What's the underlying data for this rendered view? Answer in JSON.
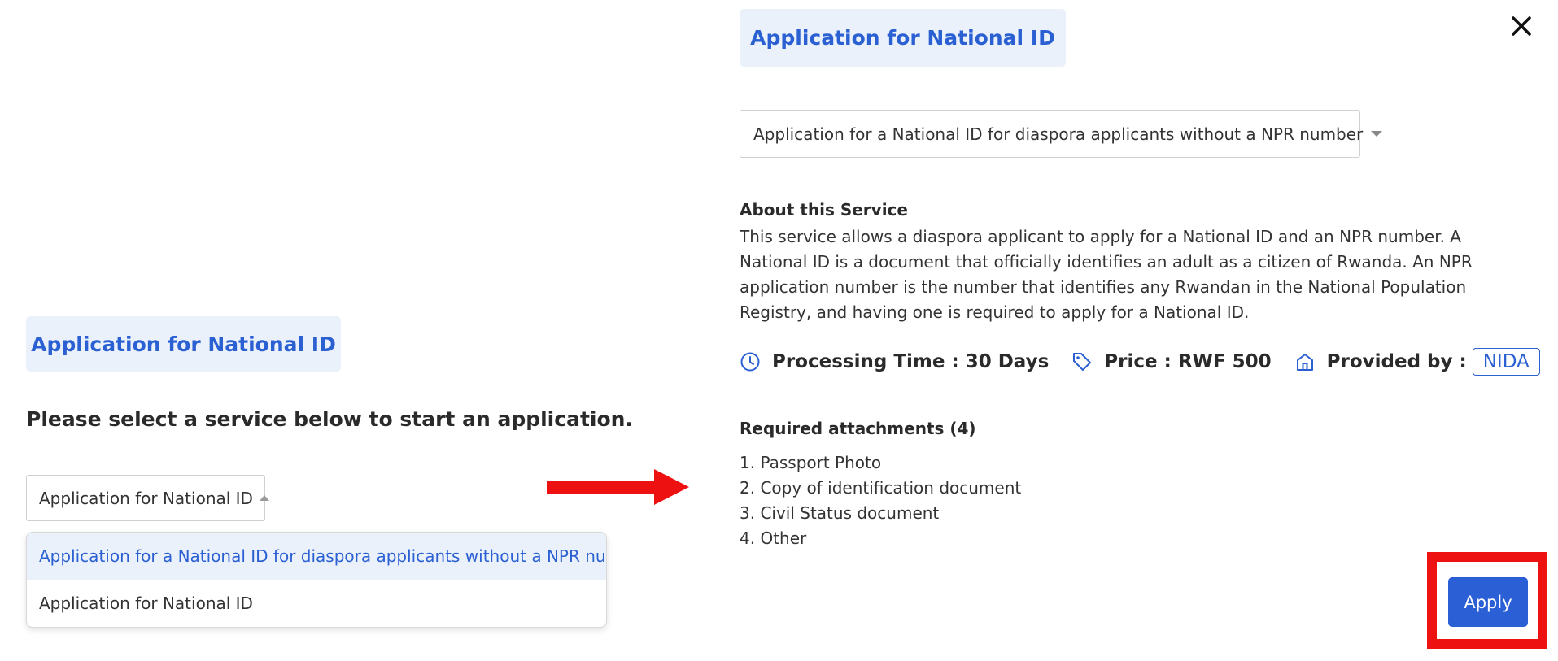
{
  "left_panel": {
    "title": "Application for National ID",
    "prompt": "Please select a service below to start an application.",
    "select_value": "Application for National ID",
    "dropdown_options": [
      "Application for a National ID for diaspora applicants without a NPR number",
      "Application for National ID"
    ],
    "highlighted_option_index": 0
  },
  "right_panel": {
    "title": "Application for National ID",
    "select_value": "Application for a National ID for diaspora applicants without a NPR number",
    "about_heading": "About this Service",
    "about_text": "This service allows a diaspora applicant to apply for a National ID and an NPR number. A National ID is a document that officially identifies an adult as a citizen of Rwanda. An NPR application number is the number that identifies any Rwandan in the National Population Registry, and having one is required to apply for a National ID.",
    "processing_time": "Processing Time : 30 Days",
    "price": "Price : RWF 500",
    "provided_by_label": "Provided by :",
    "provider": "NIDA",
    "attachments_heading": "Required attachments (4)",
    "attachments": [
      "1. Passport Photo",
      "2. Copy of identification document",
      "3. Civil Status document",
      "4. Other"
    ],
    "apply_label": "Apply"
  },
  "icons": {
    "close": "close-icon",
    "processing_time": "clock-icon",
    "price": "tag-icon",
    "provider": "home-icon",
    "arrow": "red-arrow-annotation"
  },
  "colors": {
    "accent": "#2b60d3",
    "title_bg": "#eaf1fb",
    "annotation_red": "#ee1111",
    "apply_bg": "#2b5fd6"
  }
}
